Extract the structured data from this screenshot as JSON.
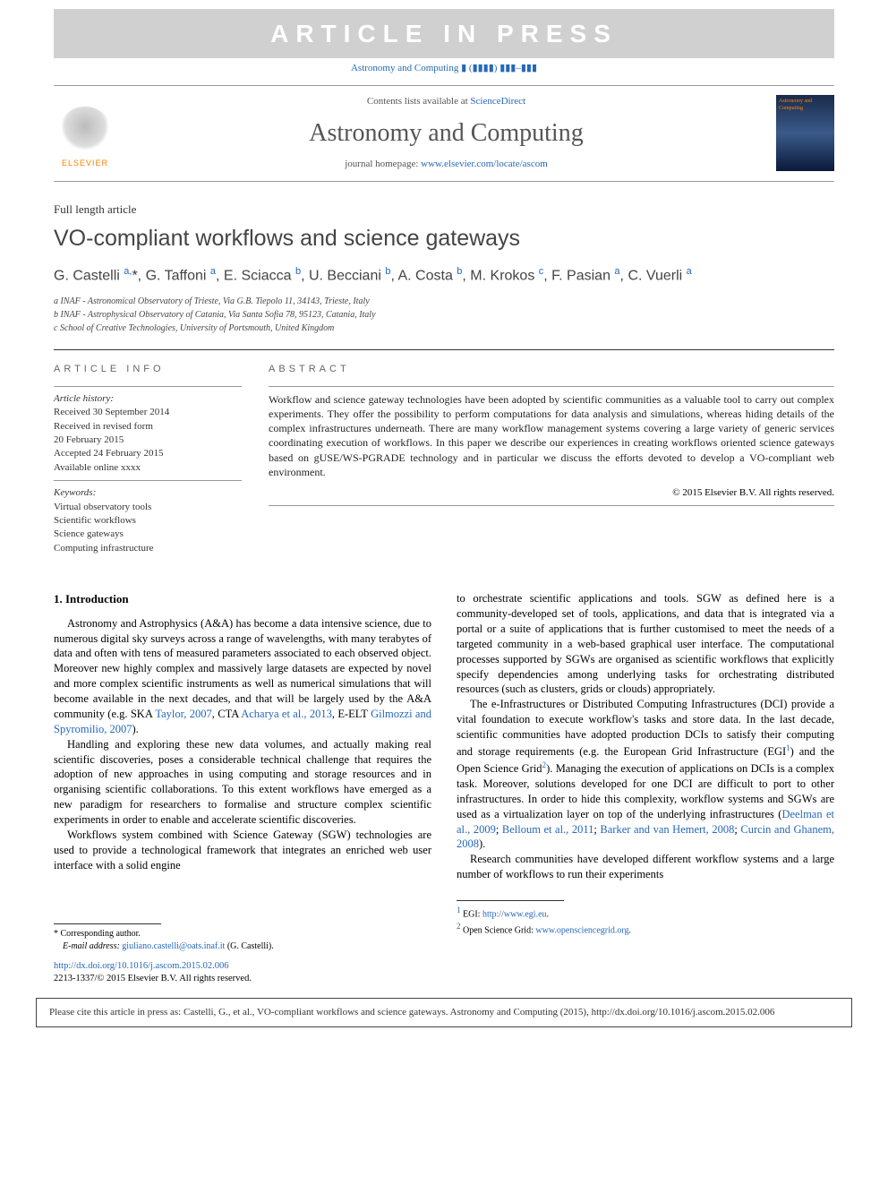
{
  "watermark": "ARTICLE IN PRESS",
  "journal_ref": "Astronomy and Computing ▮ (▮▮▮▮) ▮▮▮–▮▮▮",
  "header": {
    "contents_prefix": "Contents lists available at ",
    "contents_link": "ScienceDirect",
    "journal_name": "Astronomy and Computing",
    "homepage_prefix": "journal homepage: ",
    "homepage_link": "www.elsevier.com/locate/ascom",
    "elsevier_label": "ELSEVIER",
    "cover_text": "Astronomy and Computing"
  },
  "article_type": "Full length article",
  "title": "VO-compliant workflows and science gateways",
  "authors_html": "G. Castelli <sup>a,</sup><span class='corr'>*</span>, G. Taffoni <sup>a</sup>, E. Sciacca <sup>b</sup>, U. Becciani <sup>b</sup>, A. Costa <sup>b</sup>, M. Krokos <sup>c</sup>, F. Pasian <sup>a</sup>, C. Vuerli <sup>a</sup>",
  "affiliations": {
    "a": "a INAF - Astronomical Observatory of Trieste, Via G.B. Tiepolo 11, 34143, Trieste, Italy",
    "b": "b INAF - Astrophysical Observatory of Catania, Via Santa Sofia 78, 95123, Catania, Italy",
    "c": "c School of Creative Technologies, University of Portsmouth, United Kingdom"
  },
  "article_info": {
    "label": "ARTICLE INFO",
    "history_label": "Article history:",
    "received": "Received 30 September 2014",
    "revised1": "Received in revised form",
    "revised2": "20 February 2015",
    "accepted": "Accepted 24 February 2015",
    "online": "Available online xxxx",
    "keywords_label": "Keywords:",
    "keywords": [
      "Virtual observatory tools",
      "Scientific workflows",
      "Science gateways",
      "Computing infrastructure"
    ]
  },
  "abstract": {
    "label": "ABSTRACT",
    "text": "Workflow and science gateway technologies have been adopted by scientific communities as a valuable tool to carry out complex experiments. They offer the possibility to perform computations for data analysis and simulations, whereas hiding details of the complex infrastructures underneath. There are many workflow management systems covering a large variety of generic services coordinating execution of workflows. In this paper we describe our experiences in creating workflows oriented science gateways based on gUSE/WS-PGRADE technology and in particular we discuss the efforts devoted to develop a VO-compliant web environment.",
    "copyright": "© 2015 Elsevier B.V. All rights reserved."
  },
  "body": {
    "section1_title": "1. Introduction",
    "p1": "Astronomy and Astrophysics (A&A) has become a data intensive science, due to numerous digital sky surveys across a range of wavelengths, with many terabytes of data and often with tens of measured parameters associated to each observed object. Moreover new highly complex and massively large datasets are expected by novel and more complex scientific instruments as well as numerical simulations that will become available in the next decades, and that will be largely used by the A&A community (e.g. SKA ",
    "ref1": "Taylor, 2007",
    "p1b": ", CTA ",
    "ref2": "Acharya et al., 2013",
    "p1c": ", E-ELT ",
    "ref3": "Gilmozzi and Spyromilio, 2007",
    "p1d": ").",
    "p2": "Handling and exploring these new data volumes, and actually making real scientific discoveries, poses a considerable technical challenge that requires the adoption of new approaches in using computing and storage resources and in organising scientific collaborations. To this extent workflows have emerged as a new paradigm for researchers to formalise and structure complex scientific experiments in order to enable and accelerate scientific discoveries.",
    "p3": "Workflows system combined with Science Gateway (SGW) technologies are used to provide a technological framework that integrates an enriched web user interface with a solid engine",
    "p4": "to orchestrate scientific applications and tools. SGW as defined here is a community-developed set of tools, applications, and data that is integrated via a portal or a suite of applications that is further customised to meet the needs of a targeted community in a web-based graphical user interface. The computational processes supported by SGWs are organised as scientific workflows that explicitly specify dependencies among underlying tasks for orchestrating distributed resources (such as clusters, grids or clouds) appropriately.",
    "p5a": "The e-Infrastructures or Distributed Computing Infrastructures (DCI) provide a vital foundation to execute workflow's tasks and store data. In the last decade, scientific communities have adopted production DCIs to satisfy their computing and storage requirements (e.g. the European Grid Infrastructure (EGI",
    "p5b": ") and the Open Science Grid",
    "p5c": "). Managing the execution of applications on DCIs is a complex task. Moreover, solutions developed for one DCI are difficult to port to other infrastructures. In order to hide this complexity, workflow systems and SGWs are used as a virtualization layer on top of the underlying infrastructures (",
    "ref4": "Deelman et al., 2009",
    "ref5": "Belloum et al., 2011",
    "ref6": "Barker and van Hemert, 2008",
    "ref7": "Curcin and Ghanem, 2008",
    "p5d": ").",
    "p6": "Research communities have developed different workflow systems and a large number of workflows to run their experiments"
  },
  "left_footnotes": {
    "corr": "* Corresponding author.",
    "email_label": "E-mail address: ",
    "email": "giuliano.castelli@oats.inaf.it",
    "email_suffix": " (G. Castelli).",
    "doi": "http://dx.doi.org/10.1016/j.ascom.2015.02.006",
    "issn": "2213-1337/© 2015 Elsevier B.V. All rights reserved."
  },
  "right_footnotes": {
    "f1_label": "1",
    "f1_text": " EGI: ",
    "f1_link": "http://www.egi.eu",
    "f2_label": "2",
    "f2_text": " Open Science Grid: ",
    "f2_link": "www.opensciencegrid.org"
  },
  "cite_box": "Please cite this article in press as: Castelli, G., et al., VO-compliant workflows and science gateways. Astronomy and Computing (2015), http://dx.doi.org/10.1016/j.ascom.2015.02.006"
}
